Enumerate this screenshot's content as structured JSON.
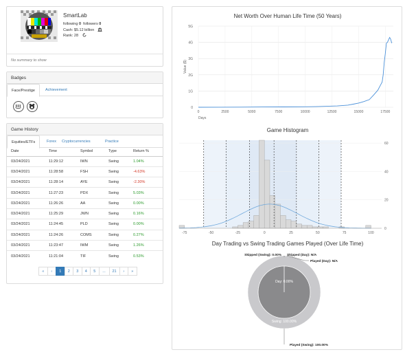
{
  "profile": {
    "name": "SmartLab",
    "following_label": "following",
    "following_count": "0",
    "followers_label": "followers",
    "followers_count": "0",
    "cash": "Cash: $5.12 billion",
    "rank": "Rank: 28",
    "summary": "No summary to show",
    "icons": [
      "bank-icon",
      "refresh-icon"
    ]
  },
  "badges": {
    "title": "Badges",
    "tabs": [
      "Face/Prestige",
      "Achievement"
    ],
    "items": [
      "badge-piggy-icon",
      "badge-bear-icon"
    ]
  },
  "history": {
    "title": "Game History",
    "tabs": [
      "Equities/ETFs",
      "Forex",
      "Cryptocurrencies",
      "Practice"
    ],
    "columns": [
      "Date",
      "Time",
      "Symbol",
      "Type",
      "Return %"
    ],
    "rows": [
      {
        "date": "03/24/2021",
        "time": "11:29:12",
        "symbol": "IWN",
        "type": "Swing",
        "ret": "1.04%",
        "sign": "pos"
      },
      {
        "date": "03/24/2021",
        "time": "11:28:58",
        "symbol": "FSH",
        "type": "Swing",
        "ret": "-4.63%",
        "sign": "neg"
      },
      {
        "date": "03/24/2021",
        "time": "11:28:14",
        "symbol": "AYE",
        "type": "Swing",
        "ret": "-2.30%",
        "sign": "neg"
      },
      {
        "date": "03/24/2021",
        "time": "11:27:23",
        "symbol": "PDX",
        "type": "Swing",
        "ret": "5.03%",
        "sign": "pos"
      },
      {
        "date": "03/24/2021",
        "time": "11:26:26",
        "symbol": "AA",
        "type": "Swing",
        "ret": "0.00%",
        "sign": "pos"
      },
      {
        "date": "03/24/2021",
        "time": "11:25:29",
        "symbol": "JWN",
        "type": "Swing",
        "ret": "0.16%",
        "sign": "pos"
      },
      {
        "date": "03/24/2021",
        "time": "11:24:45",
        "symbol": "PLD",
        "type": "Swing",
        "ret": "0.00%",
        "sign": "pos"
      },
      {
        "date": "03/24/2021",
        "time": "11:24:26",
        "symbol": "COMS",
        "type": "Swing",
        "ret": "0.27%",
        "sign": "pos"
      },
      {
        "date": "03/24/2021",
        "time": "11:23:47",
        "symbol": "IWM",
        "type": "Swing",
        "ret": "1.26%",
        "sign": "pos"
      },
      {
        "date": "03/24/2021",
        "time": "11:21:04",
        "symbol": "TIF",
        "type": "Swing",
        "ret": "0.53%",
        "sign": "pos"
      }
    ],
    "pagination": [
      "«",
      "‹",
      "1",
      "2",
      "3",
      "4",
      "5",
      "...",
      "21",
      "›",
      "»"
    ],
    "active_page": "1"
  },
  "chart_data": [
    {
      "type": "line",
      "title": "Net Worth Over Human Life Time (50 Years)",
      "xlabel": "Days",
      "ylabel": "Value ($)",
      "xlim": [
        0,
        18250
      ],
      "ylim": [
        0,
        5000000000
      ],
      "xticks": [
        "0",
        "2500",
        "5000",
        "7500",
        "10000",
        "12500",
        "15000",
        "17500"
      ],
      "yticks": [
        "0",
        "1G",
        "2G",
        "3G",
        "4G",
        "5G"
      ],
      "x": [
        0,
        2000,
        4000,
        6000,
        8000,
        10000,
        11000,
        12000,
        13000,
        14000,
        14500,
        15000,
        15500,
        16000,
        16400,
        16800,
        17000,
        17200,
        17300,
        17400,
        17500,
        17600,
        17700,
        17800,
        17900,
        18000,
        18100
      ],
      "y": [
        0,
        5000000,
        10000000,
        15000000,
        20000000,
        30000000,
        40000000,
        60000000,
        80000000,
        130000000,
        190000000,
        260000000,
        350000000,
        470000000,
        750000000,
        1050000000,
        1300000000,
        1550000000,
        2000000000,
        2800000000,
        3300000000,
        3950000000,
        4000000000,
        4150000000,
        4300000000,
        4200000000,
        3950000000
      ],
      "color": "#4a90d9",
      "grid": true
    },
    {
      "type": "bar",
      "title": "Game Histogram",
      "xlim": [
        -80,
        110
      ],
      "ylim": [
        0,
        62
      ],
      "xticks": [
        "-75",
        "-50",
        "-25",
        "0",
        "25",
        "50",
        "75",
        "100"
      ],
      "yticks": [
        "0",
        "20",
        "40",
        "60"
      ],
      "bins": [
        -77.5,
        -72.5,
        -27.5,
        -22.5,
        -17.5,
        -12.5,
        -7.5,
        -2.5,
        2.5,
        7.5,
        12.5,
        17.5,
        22.5,
        27.5,
        32.5,
        37.5,
        42.5,
        47.5,
        52.5,
        57.5,
        62.5,
        72.5,
        97.5
      ],
      "values": [
        2,
        0,
        1,
        2,
        4,
        5,
        9,
        62,
        48,
        23,
        17,
        9,
        6,
        5,
        3,
        2,
        2,
        1,
        1,
        1,
        0,
        1,
        2
      ],
      "dashed_lines": [
        -57,
        -36,
        -14,
        9,
        30,
        51,
        72
      ],
      "color": "#d9d9d9",
      "curve_color": "#6fa8dc"
    },
    {
      "type": "pie",
      "title": "Day Trading vs Swing Trading Games Played (Over Life Time)",
      "inner": [
        {
          "label": "Day: 0.00%",
          "value": 0
        },
        {
          "label": "Swing: 100.00%",
          "value": 100
        }
      ],
      "outer": [
        {
          "label": "Skipped (Swing): 0.00%",
          "value": 0
        },
        {
          "label": "Skipped (Day): N/A",
          "value": 0
        },
        {
          "label": "Played (Day): N/A",
          "value": 0
        },
        {
          "label": "Played (Swing): 100.00%",
          "value": 100
        }
      ],
      "colors": {
        "inner": "#8a8a8c",
        "outer": "#c9c9cc"
      }
    }
  ]
}
